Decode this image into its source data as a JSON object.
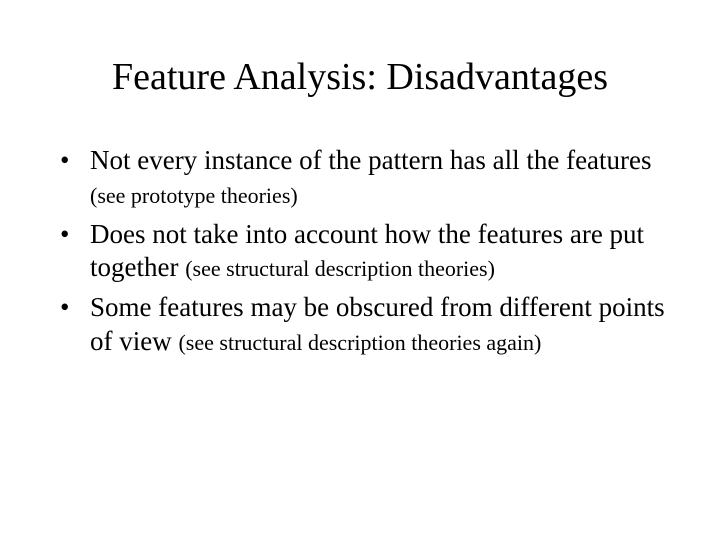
{
  "title": "Feature Analysis: Disadvantages",
  "bullets": [
    {
      "main": "Not every instance of the pattern has all the features ",
      "note": "(see prototype theories)"
    },
    {
      "main": "Does not take into account how the features are put together ",
      "note": "(see structural description theories)"
    },
    {
      "main": "Some features may be obscured from different points of view ",
      "note": "(see structural description theories again)"
    }
  ]
}
